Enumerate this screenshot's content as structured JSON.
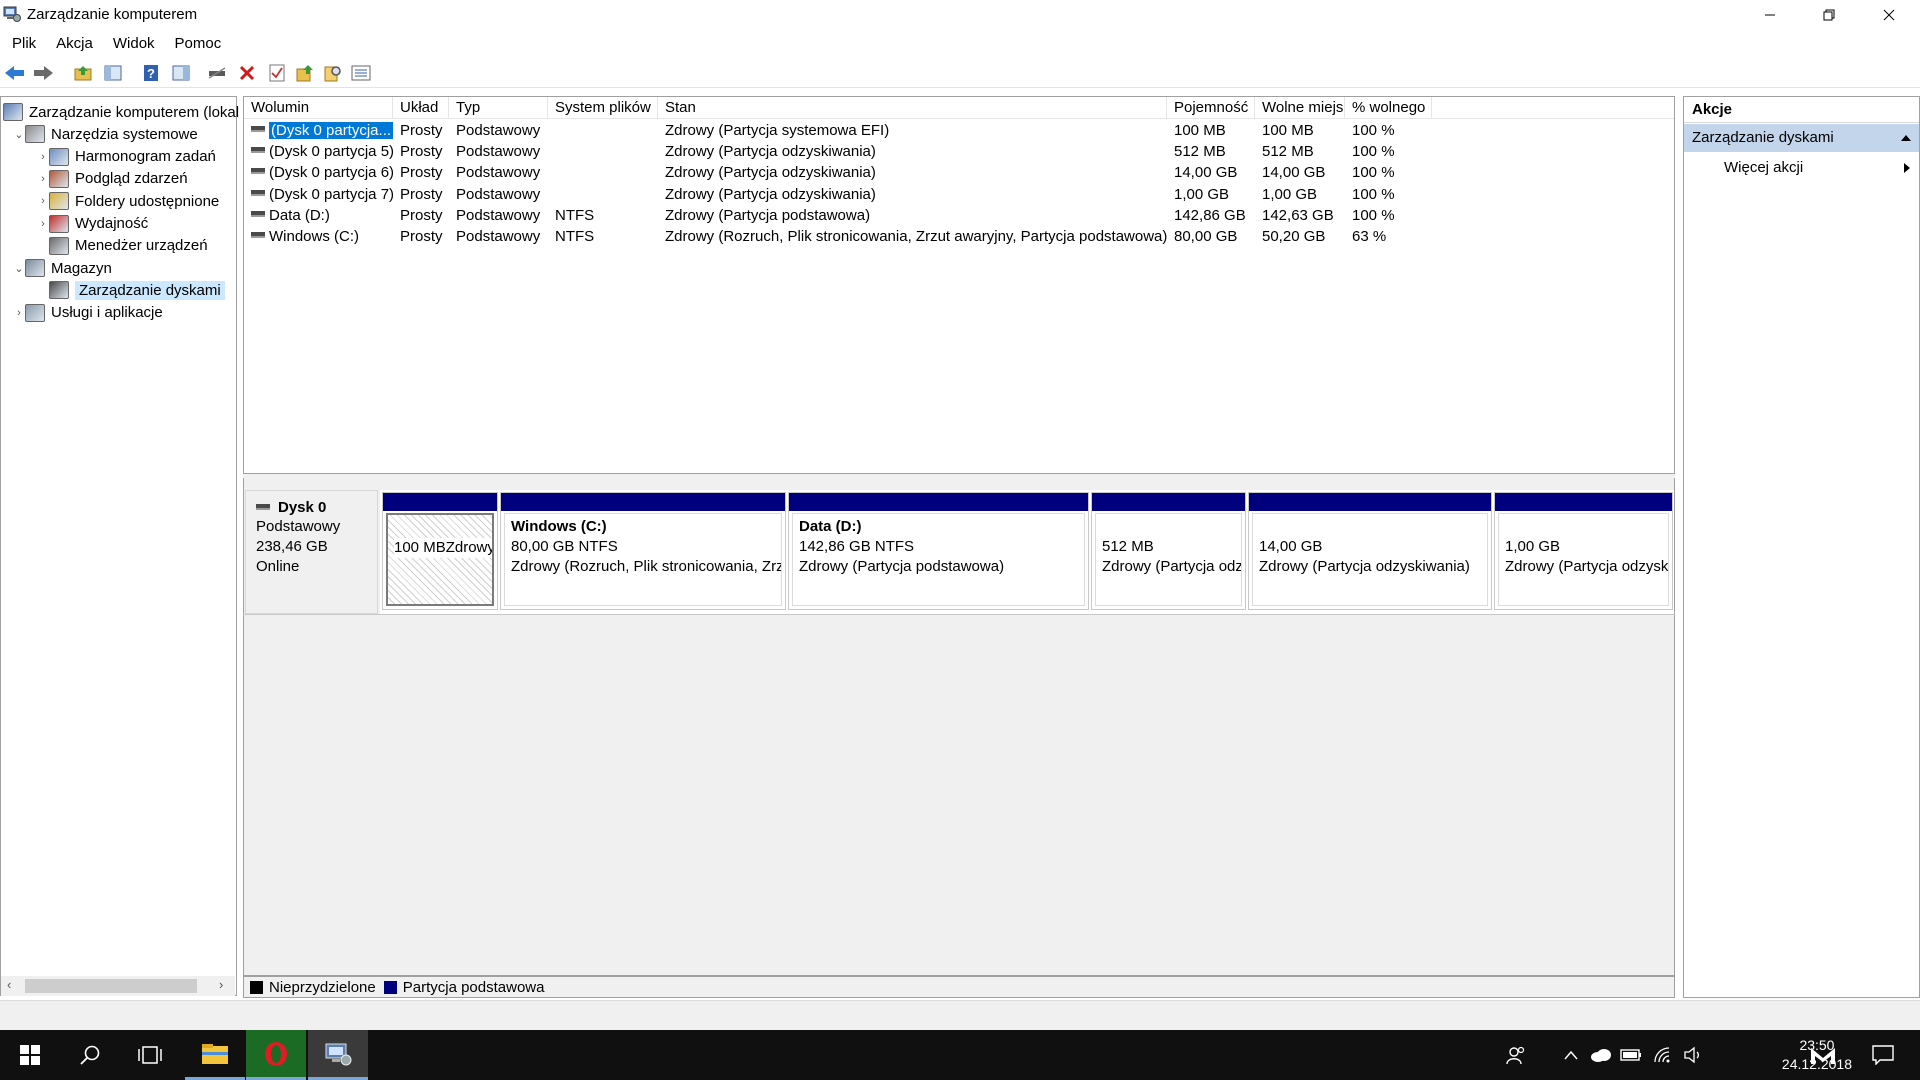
{
  "window": {
    "title": "Zarządzanie komputerem",
    "minimize": "—",
    "maximize": "❐",
    "close": "✕"
  },
  "menu": [
    "Plik",
    "Akcja",
    "Widok",
    "Pomoc"
  ],
  "toolbar_icons": [
    "back-icon",
    "forward-icon",
    "up-folder-icon",
    "show-hide-tree-icon",
    "help-icon",
    "properties-pane-icon",
    "connect-icon",
    "delete-icon",
    "check-icon",
    "export-icon",
    "search-icon",
    "list-icon"
  ],
  "tree": [
    {
      "label": "Zarządzanie komputerem (lokal",
      "level": 0,
      "arrow": "",
      "icon": "computer-management-icon"
    },
    {
      "label": "Narzędzia systemowe",
      "level": 1,
      "arrow": "⌄",
      "icon": "system-tools-icon"
    },
    {
      "label": "Harmonogram zadań",
      "level": 2,
      "arrow": "›",
      "icon": "task-scheduler-icon"
    },
    {
      "label": "Podgląd zdarzeń",
      "level": 2,
      "arrow": "›",
      "icon": "event-viewer-icon"
    },
    {
      "label": "Foldery udostępnione",
      "level": 2,
      "arrow": "›",
      "icon": "shared-folders-icon"
    },
    {
      "label": "Wydajność",
      "level": 2,
      "arrow": "›",
      "icon": "performance-icon"
    },
    {
      "label": "Menedżer urządzeń",
      "level": 2,
      "arrow": "",
      "icon": "device-manager-icon"
    },
    {
      "label": "Magazyn",
      "level": 1,
      "arrow": "⌄",
      "icon": "storage-icon"
    },
    {
      "label": "Zarządzanie dyskami",
      "level": 2,
      "arrow": "",
      "icon": "disk-management-icon",
      "selected": true
    },
    {
      "label": "Usługi i aplikacje",
      "level": 1,
      "arrow": "›",
      "icon": "services-icon"
    }
  ],
  "volumes": {
    "headers": [
      "Wolumin",
      "Układ",
      "Typ",
      "System plików",
      "Stan",
      "Pojemność",
      "Wolne miejsce",
      "% wolnego"
    ],
    "rows": [
      [
        "(Dysk 0 partycja...",
        "Prosty",
        "Podstawowy",
        "",
        "Zdrowy (Partycja systemowa EFI)",
        "100 MB",
        "100 MB",
        "100 %"
      ],
      [
        "(Dysk 0 partycja 5)",
        "Prosty",
        "Podstawowy",
        "",
        "Zdrowy (Partycja odzyskiwania)",
        "512 MB",
        "512 MB",
        "100 %"
      ],
      [
        "(Dysk 0 partycja 6)",
        "Prosty",
        "Podstawowy",
        "",
        "Zdrowy (Partycja odzyskiwania)",
        "14,00 GB",
        "14,00 GB",
        "100 %"
      ],
      [
        "(Dysk 0 partycja 7)",
        "Prosty",
        "Podstawowy",
        "",
        "Zdrowy (Partycja odzyskiwania)",
        "1,00 GB",
        "1,00 GB",
        "100 %"
      ],
      [
        "Data (D:)",
        "Prosty",
        "Podstawowy",
        "NTFS",
        "Zdrowy (Partycja podstawowa)",
        "142,86 GB",
        "142,63 GB",
        "100 %"
      ],
      [
        "Windows (C:)",
        "Prosty",
        "Podstawowy",
        "NTFS",
        "Zdrowy (Rozruch, Plik stronicowania, Zrzut awaryjny, Partycja podstawowa)",
        "80,00 GB",
        "50,20 GB",
        "63 %"
      ]
    ]
  },
  "disk": {
    "name": "Dysk 0",
    "type": "Podstawowy",
    "size": "238,46 GB",
    "status": "Online",
    "partitions": [
      {
        "title": "",
        "size": "100 MB",
        "status": "Zdrowy (Partyc"
      },
      {
        "title": "Windows  (C:)",
        "size": "80,00 GB NTFS",
        "status": "Zdrowy (Rozruch, Plik stronicowania, Zrzu"
      },
      {
        "title": "Data  (D:)",
        "size": "142,86 GB NTFS",
        "status": "Zdrowy (Partycja podstawowa)"
      },
      {
        "title": "",
        "size": "512 MB",
        "status": "Zdrowy (Partycja odz"
      },
      {
        "title": "",
        "size": "14,00 GB",
        "status": "Zdrowy (Partycja odzyskiwania)"
      },
      {
        "title": "",
        "size": "1,00 GB",
        "status": "Zdrowy (Partycja odzysk"
      }
    ]
  },
  "legend": {
    "unallocated": "Nieprzydzielone",
    "primary": "Partycja podstawowa",
    "unallocated_color": "#000000",
    "primary_color": "#00007f"
  },
  "actions": {
    "title": "Akcje",
    "section": "Zarządzanie dyskami",
    "more": "Więcej akcji"
  },
  "taskbar": {
    "time": "23:50",
    "date": "24.12.2018"
  }
}
